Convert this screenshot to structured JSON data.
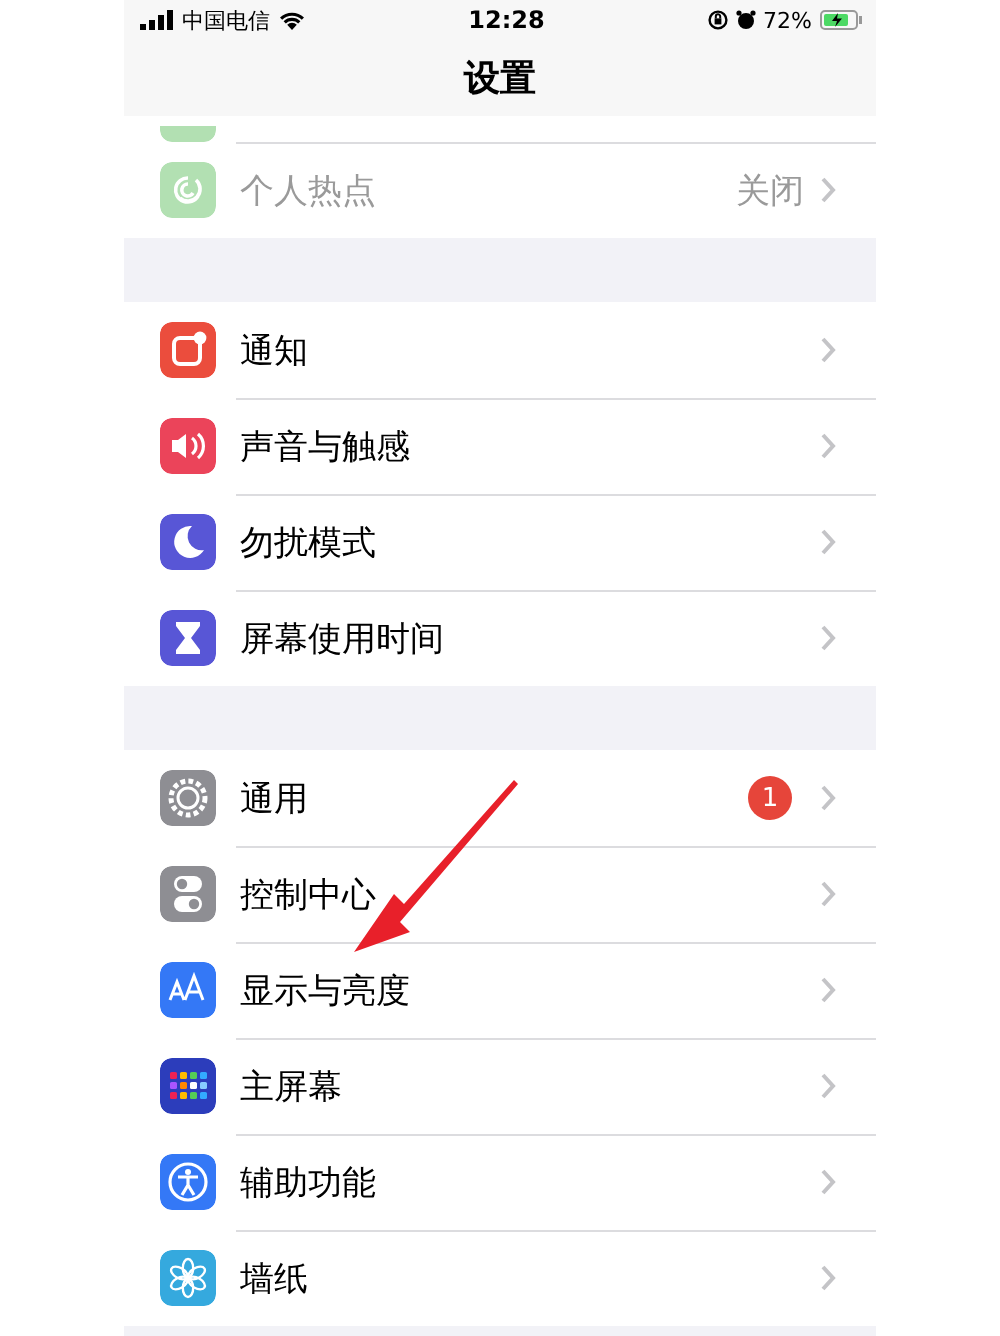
{
  "status_bar": {
    "carrier": "中国电信",
    "time": "12:28",
    "battery": "72%"
  },
  "nav": {
    "title": "设置"
  },
  "groups": [
    {
      "rows": [
        {
          "kind": "partial",
          "color": "#b2e0b2"
        },
        {
          "kind": "hotspot",
          "color": "#b2e0b2",
          "label": "个人热点",
          "value": "关闭",
          "disabled": true
        }
      ]
    },
    {
      "rows": [
        {
          "kind": "notify",
          "color": "#eb4d3d",
          "label": "通知",
          "disabled": false
        },
        {
          "kind": "sound",
          "color": "#eb445a",
          "label": "声音与触感",
          "disabled": false
        },
        {
          "kind": "moon",
          "color": "#5856d6",
          "label": "勿扰模式",
          "disabled": false
        },
        {
          "kind": "hourglass",
          "color": "#5856d6",
          "label": "屏幕使用时间",
          "disabled": false
        }
      ]
    },
    {
      "rows": [
        {
          "kind": "gear",
          "color": "#8e8e93",
          "label": "通用",
          "badge": "1",
          "disabled": false
        },
        {
          "kind": "toggles",
          "color": "#8e8e93",
          "label": "控制中心",
          "disabled": false
        },
        {
          "kind": "aa",
          "color": "#3478f6",
          "label": "显示与亮度",
          "disabled": false
        },
        {
          "kind": "grid",
          "color": "#2c3dbb",
          "label": "主屏幕",
          "disabled": false
        },
        {
          "kind": "person",
          "color": "#3478f6",
          "label": "辅助功能",
          "disabled": false
        },
        {
          "kind": "flower",
          "color": "#35a9de",
          "label": "墙纸",
          "disabled": false
        }
      ]
    }
  ]
}
